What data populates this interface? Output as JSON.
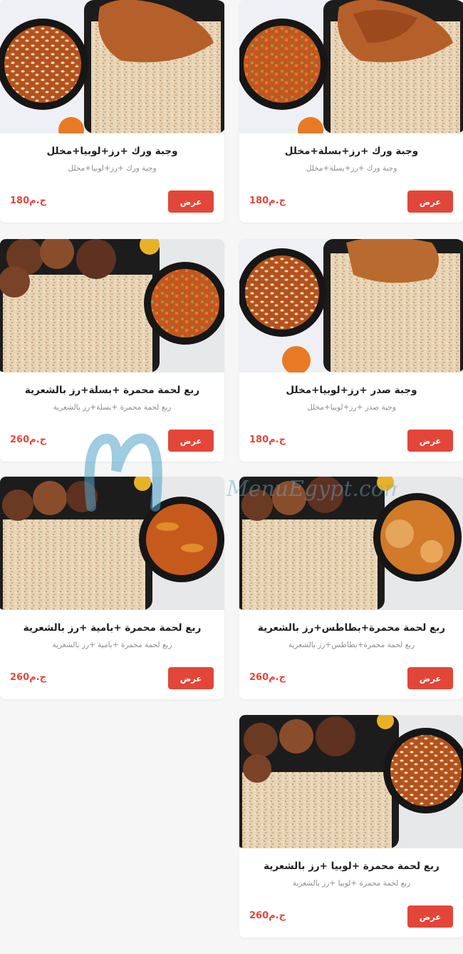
{
  "currency_accent": "#e24639",
  "watermark": {
    "text": "MenuEgypt.com"
  },
  "cards": [
    {
      "title": "وجبة ورك +رز+بسلة+مخلل",
      "subtitle": "وجبة ورك +رز+بسلة+مخلل",
      "price": "180ج.م",
      "button": "عرض",
      "image": "roast-chicken-thigh-rice-peas-stew"
    },
    {
      "title": "وجبة ورك +رز+لوبيا+مخلل",
      "subtitle": "وجبة ورك +رز+لوبيا+مخلل",
      "price": "180ج.م",
      "button": "عرض",
      "image": "roast-chicken-thigh-rice-beans-stew"
    },
    {
      "title": "وجبة صدر +رز+لوبيا+مخلل",
      "subtitle": "وجبة صدر +رز+لوبيا+مخلل",
      "price": "180ج.م",
      "button": "عرض",
      "image": "chicken-breast-rice-beans-stew"
    },
    {
      "title": "ربع لحمة محمرة +بسلة+رز بالشعرية",
      "subtitle": "ربع لحمة محمرة +بسلة+رز بالشعرية",
      "price": "260ج.م",
      "button": "عرض",
      "image": "fried-beef-vermicelli-rice-peas-stew"
    },
    {
      "title": "ربع لحمة محمرة+بطاطس+رز بالشعرية",
      "subtitle": "ربع لحمة محمرة+بطاطس+رز بالشعرية",
      "price": "260ج.م",
      "button": "عرض",
      "image": "fried-beef-vermicelli-rice-potato-stew"
    },
    {
      "title": "ربع لحمة محمرة +بامية +رز بالشعرية",
      "subtitle": "ربع لحمة محمرة +بامية +رز بالشعرية",
      "price": "260ج.م",
      "button": "عرض",
      "image": "fried-beef-vermicelli-rice-okra-stew"
    },
    {
      "title": "ربع لحمة محمرة +لوبيا +رز بالشعرية",
      "subtitle": "ربع لحمة محمرة +لوبيا +رز بالشعرية",
      "price": "260ج.م",
      "button": "عرض",
      "image": "fried-beef-vermicelli-rice-beans-stew"
    }
  ]
}
